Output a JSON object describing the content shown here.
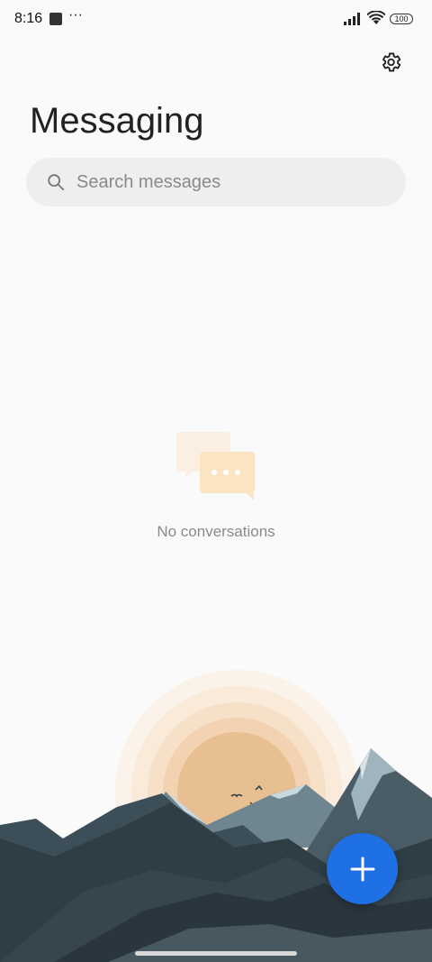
{
  "status_bar": {
    "time": "8:16",
    "overflow": "···",
    "battery": "100"
  },
  "header": {
    "title": "Messaging",
    "settings_icon": "gear-icon"
  },
  "search": {
    "placeholder": "Search messages",
    "value": ""
  },
  "empty_state": {
    "icon": "chat-bubbles-icon",
    "text": "No conversations"
  },
  "fab": {
    "icon": "plus-icon",
    "color": "#1f6fe5"
  },
  "colors": {
    "background": "#fafafa",
    "accent": "#1f6fe5",
    "sun": "#e8bf91",
    "mountain_dark": "#2f3d45"
  }
}
